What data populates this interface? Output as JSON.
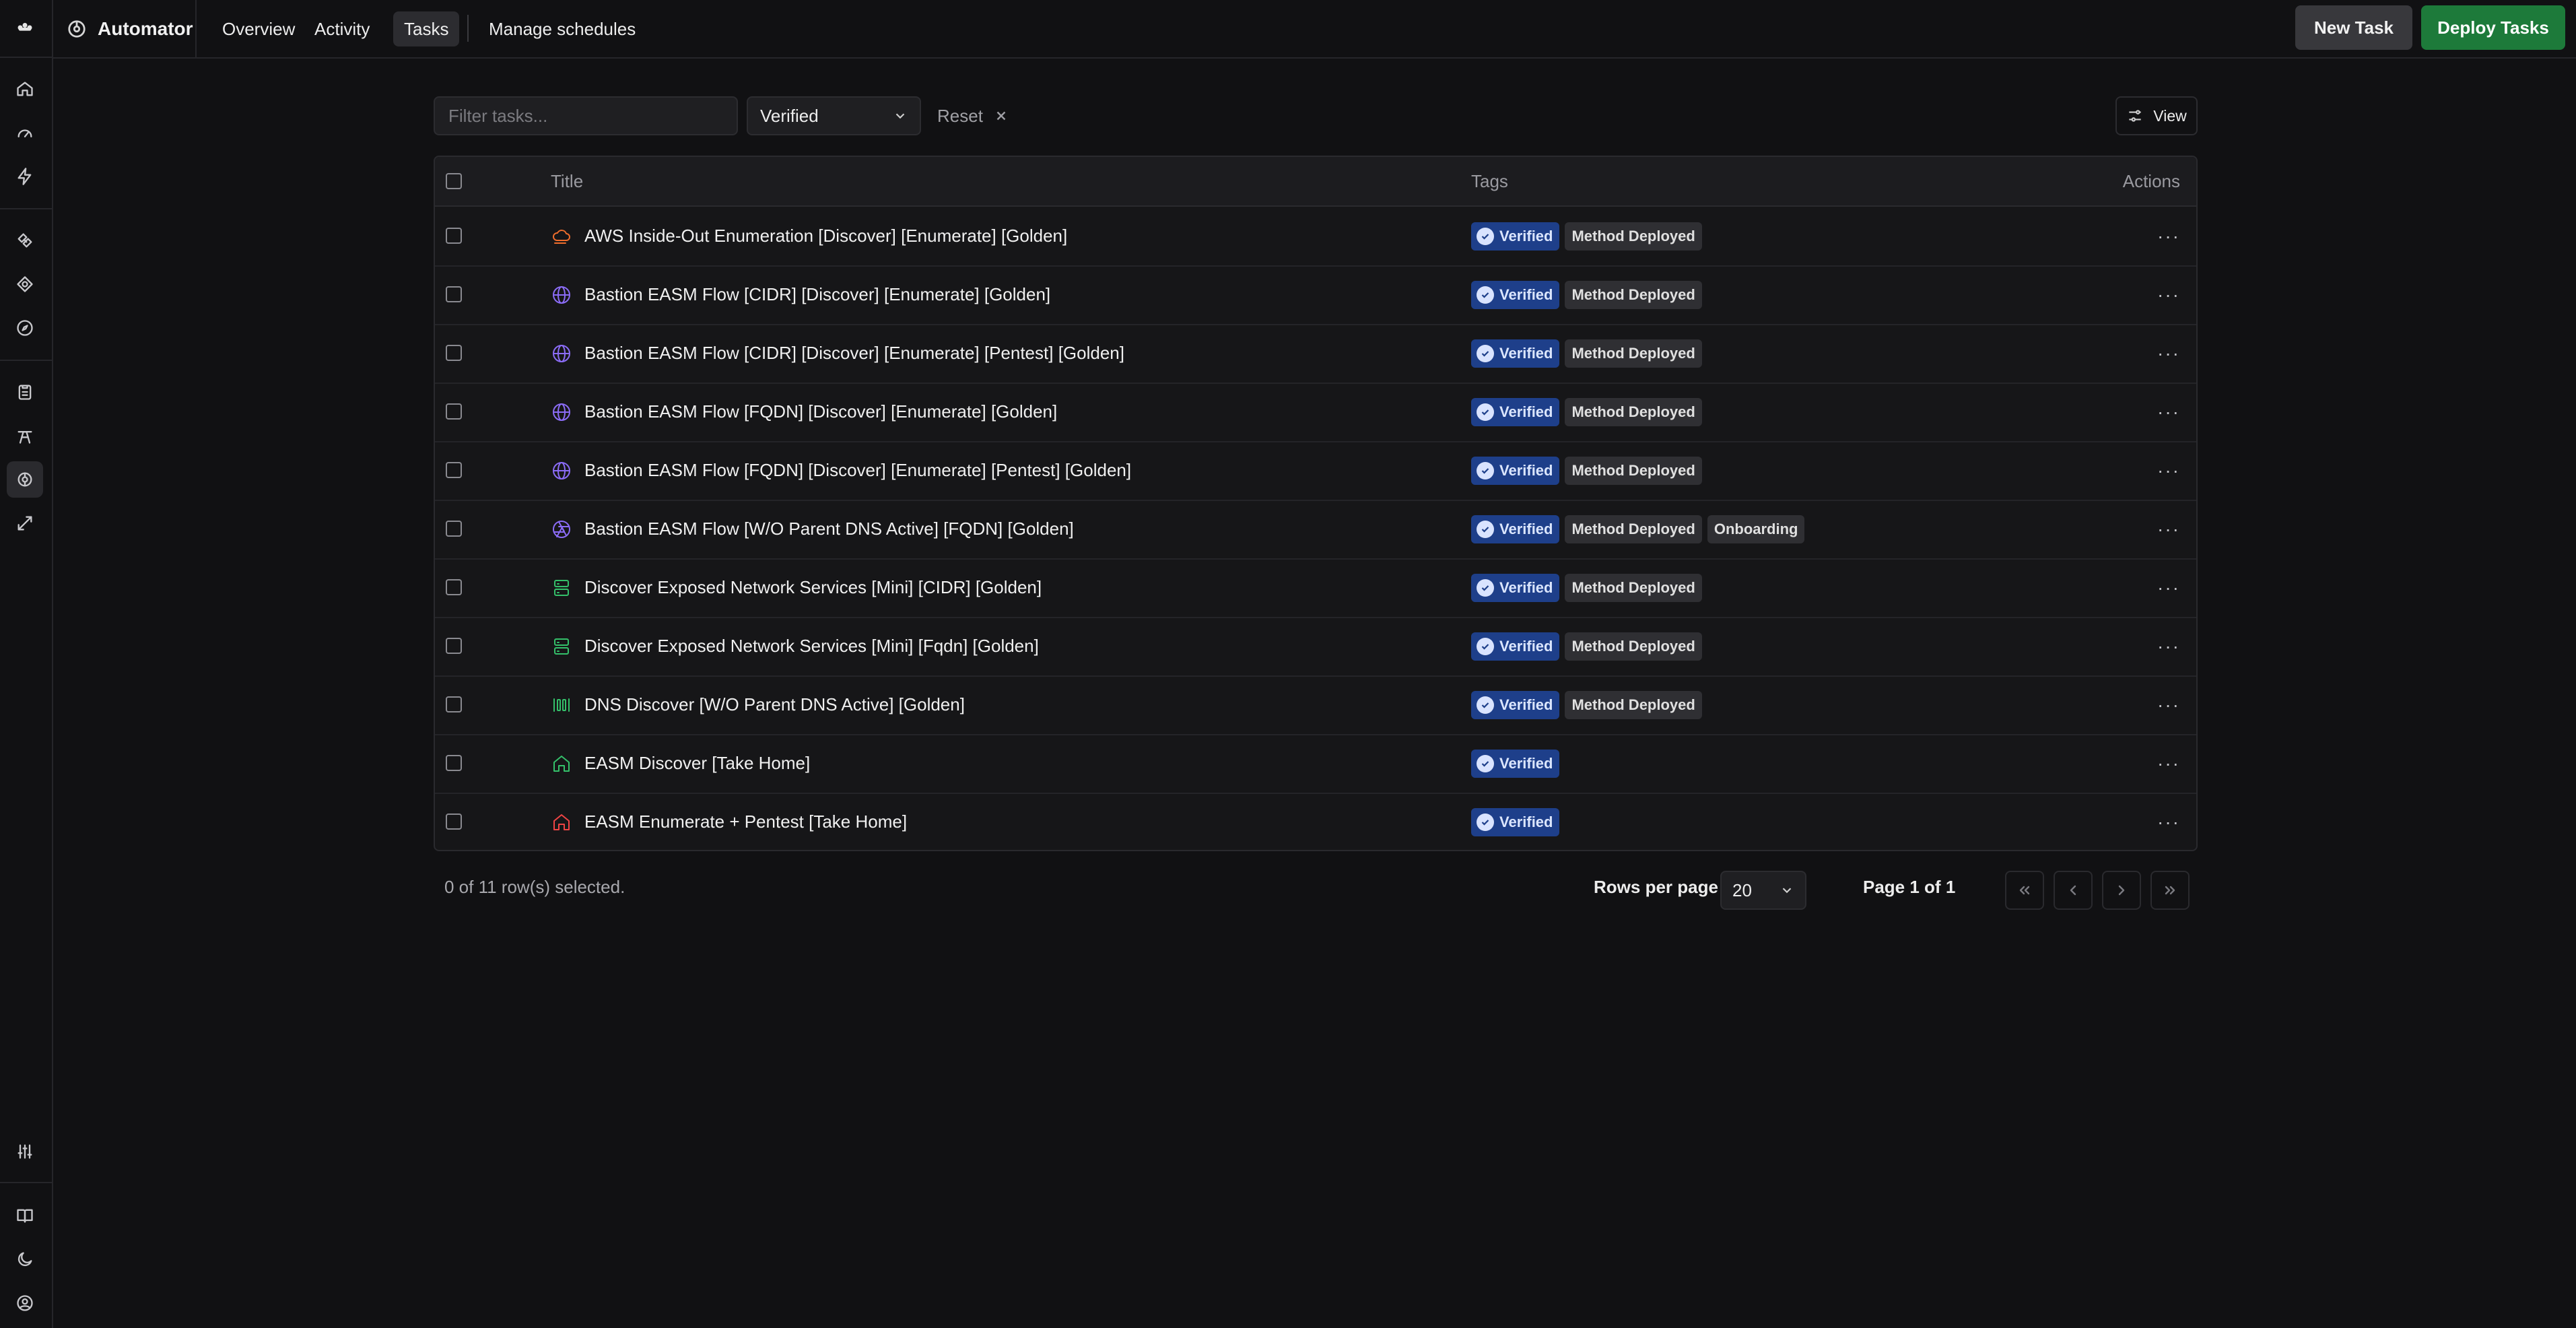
{
  "app": {
    "name": "Automator"
  },
  "nav": {
    "items": [
      {
        "label": "Overview",
        "active": false
      },
      {
        "label": "Activity",
        "active": false
      },
      {
        "label": "Tasks",
        "active": true
      },
      {
        "label": "Manage schedules",
        "active": false
      }
    ]
  },
  "actions": {
    "new_task": "New Task",
    "deploy_tasks": "Deploy Tasks"
  },
  "toolbar": {
    "filter_placeholder": "Filter tasks...",
    "filter_value": "",
    "status_select": "Verified",
    "reset_label": "Reset",
    "view_label": "View"
  },
  "table": {
    "headers": {
      "title": "Title",
      "tags": "Tags",
      "actions": "Actions"
    },
    "rows": [
      {
        "title": "AWS Inside-Out Enumeration [Discover] [Enumerate] [Golden]",
        "icon": "cloud-icon",
        "tags": [
          "Verified",
          "Method Deployed"
        ]
      },
      {
        "title": "Bastion EASM Flow [CIDR] [Discover] [Enumerate] [Golden]",
        "icon": "globe-icon",
        "tags": [
          "Verified",
          "Method Deployed"
        ]
      },
      {
        "title": "Bastion EASM Flow [CIDR] [Discover] [Enumerate] [Pentest] [Golden]",
        "icon": "globe-icon",
        "tags": [
          "Verified",
          "Method Deployed"
        ]
      },
      {
        "title": "Bastion EASM Flow [FQDN] [Discover] [Enumerate] [Golden]",
        "icon": "globe-icon",
        "tags": [
          "Verified",
          "Method Deployed"
        ]
      },
      {
        "title": "Bastion EASM Flow [FQDN] [Discover] [Enumerate] [Pentest] [Golden]",
        "icon": "globe-icon",
        "tags": [
          "Verified",
          "Method Deployed"
        ]
      },
      {
        "title": "Bastion EASM Flow [W/O Parent DNS Active] [FQDN] [Golden]",
        "icon": "aperture-icon",
        "tags": [
          "Verified",
          "Method Deployed",
          "Onboarding"
        ]
      },
      {
        "title": "Discover Exposed Network Services [Mini] [CIDR] [Golden]",
        "icon": "server-icon",
        "tags": [
          "Verified",
          "Method Deployed"
        ]
      },
      {
        "title": "Discover Exposed Network Services [Mini] [Fqdn] [Golden]",
        "icon": "server-icon",
        "tags": [
          "Verified",
          "Method Deployed"
        ]
      },
      {
        "title": "DNS Discover [W/O Parent DNS Active] [Golden]",
        "icon": "columns-icon",
        "tags": [
          "Verified",
          "Method Deployed"
        ]
      },
      {
        "title": "EASM Discover [Take Home]",
        "icon": "home-icon",
        "tags": [
          "Verified"
        ]
      },
      {
        "title": "EASM Enumerate + Pentest [Take Home]",
        "icon": "home-icon",
        "tags": [
          "Verified"
        ]
      }
    ],
    "row_actions": "···"
  },
  "footer": {
    "selected_text": "0 of 11 row(s) selected.",
    "rows_per_page_label": "Rows per page",
    "rows_per_page_value": "20",
    "page_text": "Page 1 of 1"
  },
  "colors": {
    "background": "#111113",
    "deploy_green": "#1d7a3a",
    "verified_blue": "#1e3f8a",
    "icon_orange": "#f06d2c",
    "icon_purple": "#8b6cf6",
    "icon_green": "#34c06a",
    "icon_red": "#ef4444"
  }
}
